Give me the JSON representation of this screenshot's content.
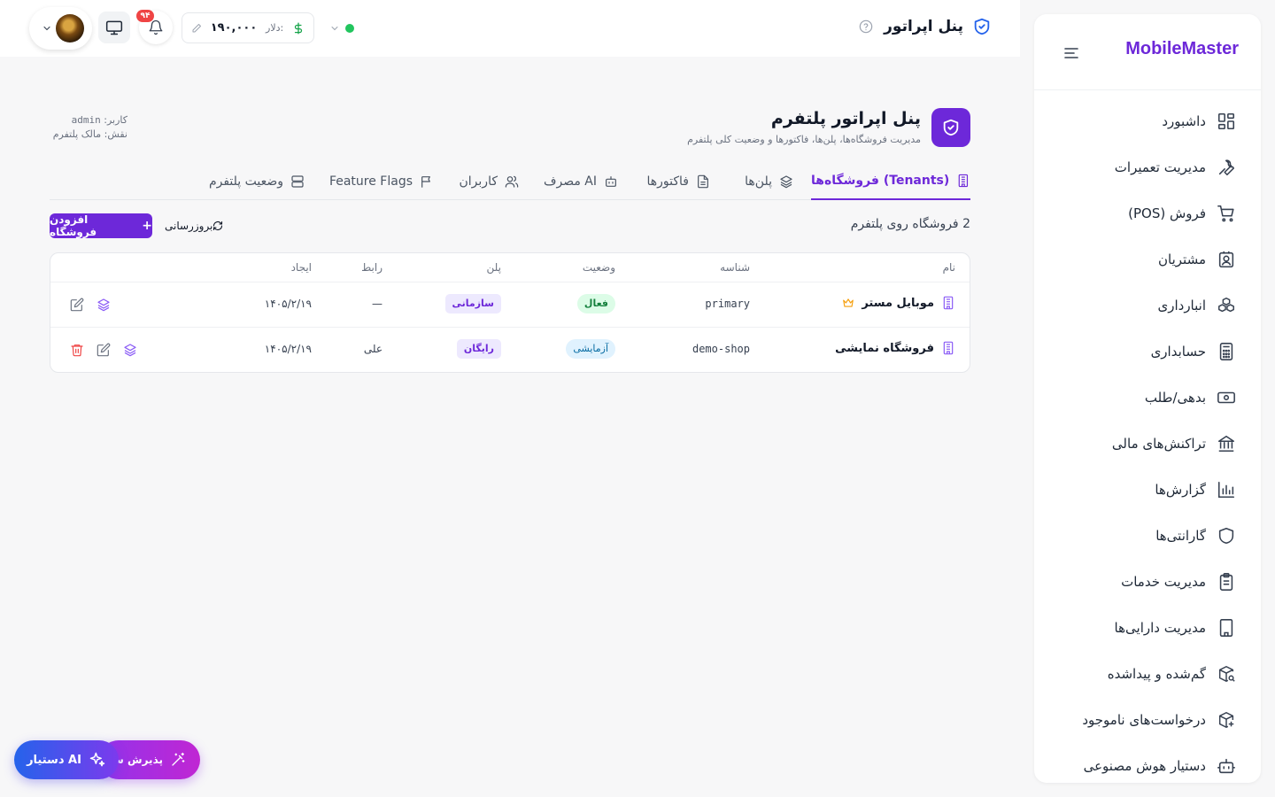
{
  "sidebar": {
    "brand": "MobileMaster",
    "items": [
      {
        "label": "داشبورد",
        "icon": "dashboard-icon"
      },
      {
        "label": "مدیریت تعمیرات",
        "icon": "wrench-icon"
      },
      {
        "label": "فروش (POS)",
        "icon": "cart-icon"
      },
      {
        "label": "مشتریان",
        "icon": "contact-icon"
      },
      {
        "label": "انبارداری",
        "icon": "boxes-icon"
      },
      {
        "label": "حسابداری",
        "icon": "calculator-icon"
      },
      {
        "label": "بدهی/طلب",
        "icon": "banknote-icon"
      },
      {
        "label": "تراکنش‌های مالی",
        "icon": "bank-icon"
      },
      {
        "label": "گزارش‌ها",
        "icon": "chart-icon"
      },
      {
        "label": "گارانتی‌ها",
        "icon": "shield-icon"
      },
      {
        "label": "مدیریت خدمات",
        "icon": "clipboard-icon"
      },
      {
        "label": "مدیریت دارایی‌ها",
        "icon": "building-icon"
      },
      {
        "label": "گم‌شده و پیداشده",
        "icon": "package-search-icon"
      },
      {
        "label": "درخواست‌های ناموجود",
        "icon": "package-plus-icon"
      },
      {
        "label": "دستیار هوش مصنوعی",
        "icon": "bot-icon"
      }
    ]
  },
  "topbar": {
    "title": "پنل اپراتور",
    "dollar_label": "دلار:",
    "dollar_value": "۱۹۰,۰۰۰",
    "notification_count": "۹۴"
  },
  "page": {
    "title": "پنل اپراتور پلتفرم",
    "subtitle": "مدیریت فروشگاه‌ها، پلن‌ها، فاکتورها و وضعیت کلی پلتفرم",
    "user_label": "کاربر:",
    "user_value": "admin",
    "role_line": "نقش: مالک پلتفرم"
  },
  "tabs": [
    {
      "label": "فروشگاه‌ها (Tenants)",
      "active": true
    },
    {
      "label": "پلن‌ها"
    },
    {
      "label": "فاکتورها"
    },
    {
      "label": "مصرف AI"
    },
    {
      "label": "کاربران"
    },
    {
      "label": "Feature Flags"
    },
    {
      "label": "وضعیت پلتفرم"
    }
  ],
  "toolbar": {
    "count_label": "2 فروشگاه روی پلتفرم",
    "refresh_label": "بروزرسانی",
    "add_label": "افزودن فروشگاه"
  },
  "table": {
    "columns": [
      "نام",
      "شناسه",
      "وضعیت",
      "پلن",
      "رابط",
      "ایجاد"
    ],
    "rows": [
      {
        "name": "موبایل مستر",
        "slug": "primary",
        "status": "فعال",
        "plan": "سازمانی",
        "contact": "—",
        "created": "۱۴۰۵/۲/۱۹"
      },
      {
        "name": "فروشگاه نمایشی",
        "slug": "demo-shop",
        "status": "آزمایشی",
        "plan": "رایگان",
        "contact": "علی",
        "created": "۱۴۰۵/۲/۱۹"
      }
    ]
  },
  "fabs": {
    "accept_label": "پذیرش س",
    "ai_label": "دستیار AI"
  },
  "colors": {
    "accent": "#6d28d9",
    "status_online": "#22c55e",
    "danger": "#ef4444"
  }
}
